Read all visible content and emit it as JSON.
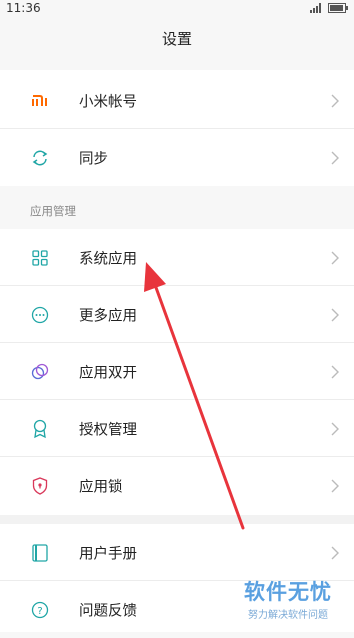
{
  "status": {
    "time": "11:36"
  },
  "header": {
    "title": "设置"
  },
  "account": [
    {
      "label": "小米帐号",
      "icon": "mi-logo-icon"
    },
    {
      "label": "同步",
      "icon": "sync-icon"
    }
  ],
  "apps_section": {
    "title": "应用管理",
    "items": [
      {
        "label": "系统应用",
        "icon": "grid-icon"
      },
      {
        "label": "更多应用",
        "icon": "more-dots-icon"
      },
      {
        "label": "应用双开",
        "icon": "dual-app-icon"
      },
      {
        "label": "授权管理",
        "icon": "badge-icon"
      },
      {
        "label": "应用锁",
        "icon": "shield-lock-icon"
      }
    ]
  },
  "help": [
    {
      "label": "用户手册",
      "icon": "book-icon"
    },
    {
      "label": "问题反馈",
      "icon": "question-icon"
    }
  ],
  "watermark": {
    "main": "软件无忧",
    "sub": "努力解决软件问题"
  },
  "colors": {
    "accent": "#20a6a6",
    "mi": "#ff6900",
    "arrow": "#e8343c",
    "lock": "#d9385a"
  }
}
